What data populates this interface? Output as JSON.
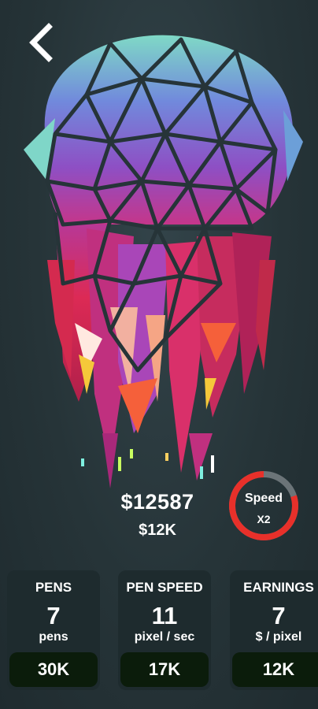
{
  "header": {
    "back_icon": "chevron-left-icon"
  },
  "artwork": {
    "subject": "low-poly jellyfish",
    "palette": [
      "#7fd6c8",
      "#6c7ed8",
      "#a44bb6",
      "#d6295a",
      "#f5603a",
      "#f5c83a"
    ]
  },
  "money": {
    "total": "$12587",
    "per_second": "$12K"
  },
  "speed_boost": {
    "label": "Speed",
    "multiplier": "X2",
    "progress": 0.2,
    "ring_color": "#e8302a",
    "track_color": "#6b7478"
  },
  "upgrades": [
    {
      "title": "PENS",
      "value": "7",
      "unit": "pens",
      "cost": "30K"
    },
    {
      "title": "PEN SPEED",
      "value": "11",
      "unit": "pixel / sec",
      "cost": "17K"
    },
    {
      "title": "EARNINGS",
      "value": "7",
      "unit": "$ / pixel",
      "cost": "12K"
    }
  ]
}
